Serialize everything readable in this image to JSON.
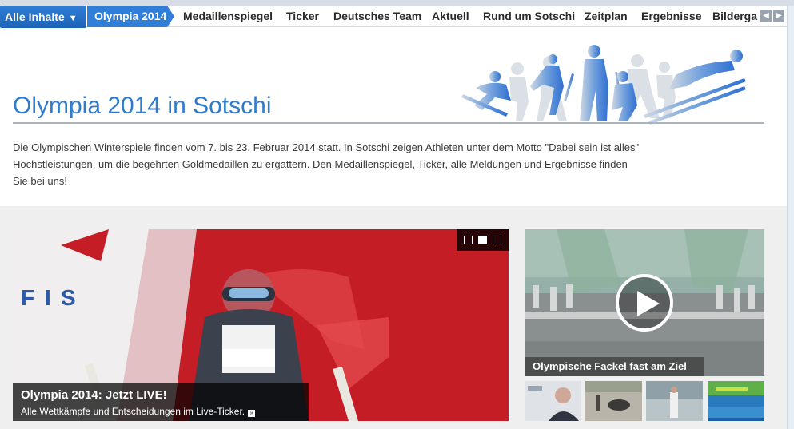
{
  "nav": {
    "all_label": "Alle Inhalte",
    "active_label": "Olympia 2014",
    "items": [
      "Medaillenspiegel",
      "Ticker",
      "Deutsches Team",
      "Aktuell",
      "Rund um Sotschi",
      "Zeitplan",
      "Ergebnisse",
      "Bilderga"
    ],
    "prev_icon": "chevron-left-icon",
    "next_icon": "chevron-right-icon"
  },
  "header": {
    "title": "Olympia 2014 in Sotschi",
    "intro": "Die Olympischen Winterspiele finden vom 7. bis 23. Februar 2014 statt. In Sotschi zeigen Athleten unter dem Motto \"Dabei sein ist alles\" Höchstleistungen, um die begehrten Goldmedaillen zu ergattern. Den Medaillenspiegel, Ticker, alle Meldungen und Ergebnisse finden Sie bei uns!"
  },
  "teaser": {
    "headline": "Olympia 2014: Jetzt LIVE!",
    "subline": "Alle Wettkämpfe und Entscheidungen im Live-Ticker.",
    "slides_total": 3,
    "slide_active": 2
  },
  "video": {
    "caption": "Olympische Fackel fast am Ziel",
    "icon": "play-icon"
  },
  "colors": {
    "accent": "#2f7ccf",
    "nav_active": "#2f7ed8",
    "teaser_bg": "#c91f26"
  }
}
